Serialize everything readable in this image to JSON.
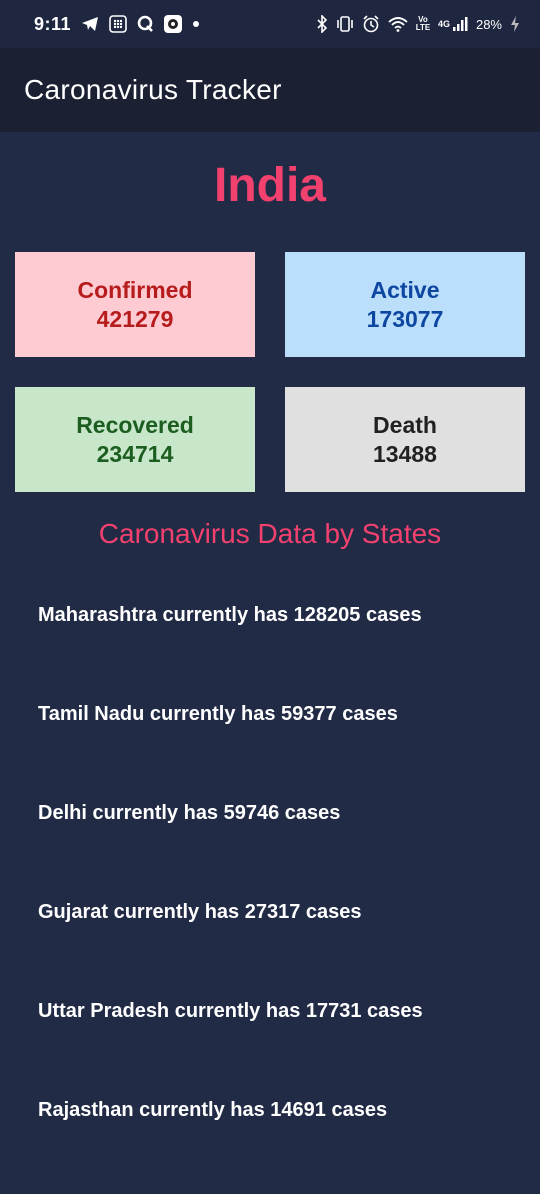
{
  "status_bar": {
    "time": "9:11",
    "battery": "28%",
    "left_icons": [
      "telegram-icon",
      "grid-app-icon",
      "q-app-icon",
      "c-app-icon",
      "dot-icon"
    ],
    "right_icons": [
      "bluetooth-icon",
      "vibrate-icon",
      "alarm-icon",
      "wifi-icon",
      "volte-icon",
      "signal-4g-icon",
      "battery-charging-icon"
    ],
    "volte_text": "Vo LTE",
    "network_text": "4G"
  },
  "app_bar": {
    "title": "Caronavirus Tracker"
  },
  "country": "India",
  "stats": {
    "confirmed": {
      "label": "Confirmed",
      "value": "421279"
    },
    "active": {
      "label": "Active",
      "value": "173077"
    },
    "recovered": {
      "label": "Recovered",
      "value": "234714"
    },
    "death": {
      "label": "Death",
      "value": "13488"
    }
  },
  "section_title": "Caronavirus Data by States",
  "states": [
    "Maharashtra currently has 128205 cases",
    "Tamil Nadu currently has 59377 cases",
    "Delhi currently has 59746 cases",
    "Gujarat currently has 27317 cases",
    "Uttar Pradesh currently has 17731 cases",
    "Rajasthan currently has 14691 cases"
  ],
  "colors": {
    "background": "#222b46",
    "app_bar": "#1b2133",
    "accent": "#f2416e"
  }
}
